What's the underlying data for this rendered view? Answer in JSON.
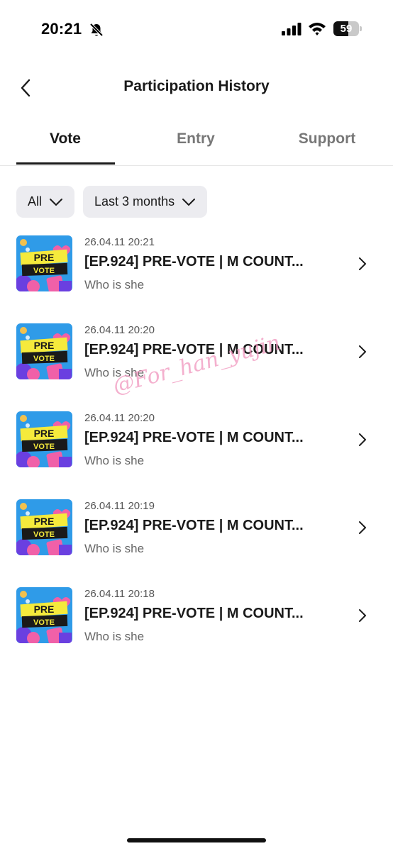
{
  "status_bar": {
    "time": "20:21",
    "battery_level": "59",
    "battery_fraction": 0.59
  },
  "header": {
    "title": "Participation History",
    "back_icon": "chevron-left-icon"
  },
  "tabs": [
    {
      "label": "Vote",
      "active": true
    },
    {
      "label": "Entry",
      "active": false
    },
    {
      "label": "Support",
      "active": false
    }
  ],
  "filters": {
    "type": {
      "label": "All"
    },
    "period": {
      "label": "Last 3 months"
    }
  },
  "items": [
    {
      "date": "26.04.11 20:21",
      "title": "[EP.924] PRE-VOTE | M COUNT...",
      "subtitle": "Who is she"
    },
    {
      "date": "26.04.11 20:20",
      "title": "[EP.924] PRE-VOTE | M COUNT...",
      "subtitle": "Who is she"
    },
    {
      "date": "26.04.11 20:20",
      "title": "[EP.924] PRE-VOTE | M COUNT...",
      "subtitle": "Who is she"
    },
    {
      "date": "26.04.11 20:19",
      "title": "[EP.924] PRE-VOTE | M COUNT...",
      "subtitle": "Who is she"
    },
    {
      "date": "26.04.11 20:18",
      "title": "[EP.924] PRE-VOTE | M COUNT...",
      "subtitle": "Who is she"
    }
  ],
  "thumbnail": {
    "line1": "PRE",
    "line2": "VOTE",
    "colors": {
      "sky": "#2f9be8",
      "banner": "#f5ea3c",
      "pink": "#f060a8",
      "purple": "#6a3fe0"
    }
  },
  "watermark": "@For_han_yujin",
  "colors": {
    "text": "#1a1a1a",
    "muted": "#777777",
    "chip_bg": "#ececf0",
    "divider": "#e6e6e6"
  }
}
